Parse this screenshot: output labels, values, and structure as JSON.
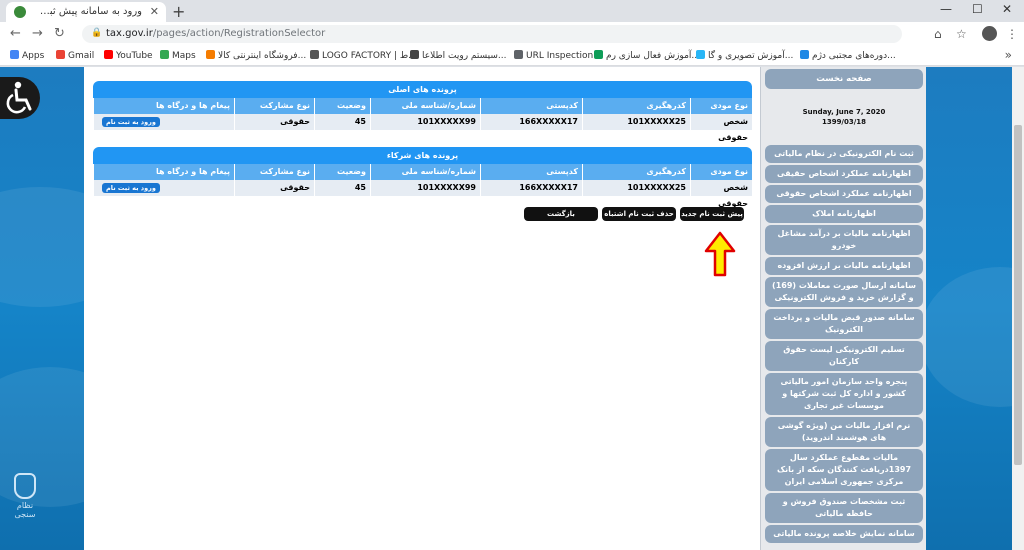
{
  "browser": {
    "tab_title": "ورود به سامانه پیش ثبت نام و ثبت...",
    "url_host": "tax.gov.ir",
    "url_path": "/pages/action/RegistrationSelector",
    "bookmarks": [
      "Apps",
      "Gmail",
      "YouTube",
      "Maps",
      "فروشگاه اینترنتی کالا...",
      "LOGO FACTORY | ط...",
      "سیستم رویت اطلاعا...",
      "URL Inspection",
      "آموزش فعال سازی رم...",
      "آموزش تصویری و گا...",
      "دوره‌های مجتبی دژم..."
    ]
  },
  "main_table": {
    "title": "پرونده های اصلی",
    "columns": [
      "نوع مودی",
      "کدرهگیری",
      "کدپستی",
      "شماره/شناسه ملی",
      "وضعیت",
      "نوع مشارکت",
      "پیغام ها و درگاه ها"
    ],
    "row": [
      "شخص حقوقی",
      "101XXXXX25",
      "166XXXXX17",
      "101XXXXX99",
      "45",
      "حقوقی",
      ""
    ],
    "login_button": "ورود به ثبت نام"
  },
  "partner_table": {
    "title": "پرونده های شرکاء",
    "columns": [
      "نوع مودی",
      "کدرهگیری",
      "کدپستی",
      "شماره/شناسه ملی",
      "وضعیت",
      "نوع مشارکت",
      "پیغام ها و درگاه ها"
    ],
    "row": [
      "شخص حقوقی",
      "101XXXXX25",
      "166XXXXX17",
      "101XXXXX99",
      "45",
      "حقوقی",
      ""
    ],
    "login_button": "ورود به ثبت نام"
  },
  "actions": {
    "new_registration": "پیش ثبت نام جدید",
    "delete_mistaken": "حذف ثبت نام اشتباه",
    "back": "بازگشت"
  },
  "sidebar": {
    "home": "صفحه نخست",
    "date_en": "Sunday, June 7, 2020",
    "date_fa": "1399/03/18",
    "items": [
      "ثبت نام الکترونیکی در نظام مالیاتی",
      "اظهارنامه عملکرد اشخاص حقیقی",
      "اظهارنامه عملکرد اشخاص حقوقی",
      "اظهارنامه املاک",
      "اظهارنامه مالیات بر درآمد مشاغل خودرو",
      "اظهارنامه مالیات بر ارزش افزوده",
      "سامانه ارسال صورت معاملات (169) و گزارش خرید و فروش الکترونیکی",
      "سامانه صدور قبض مالیات و پرداخت الکترونیک",
      "تسلیم الکترونیکی لیست حقوق کارکنان",
      "پنجره واحد سازمان امور مالیاتی کشور و اداره کل ثبت شرکتها و موسسات غیر تجاری",
      "نرم افزار مالیات من (ویژه گوشی های هوشمند اندروید)",
      "مالیات مقطوع عملکرد سال 1397دریافت کنندگان سکه از بانک مرکزی جمهوری اسلامی ایران",
      "ثبت مشخصات صندوق فروش و حافظه مالیاتی",
      "سامانه نمایش خلاصه پرونده مالیاتی"
    ]
  },
  "logo_text": "نظام سنجی"
}
